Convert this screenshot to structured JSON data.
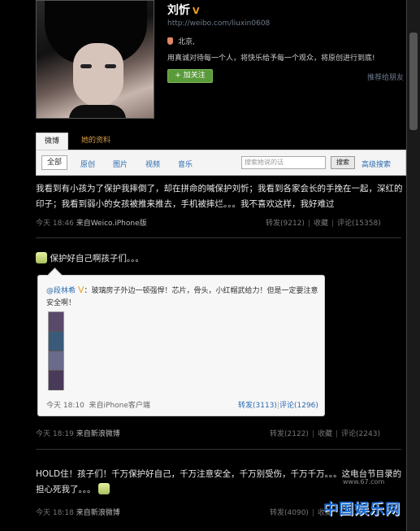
{
  "profile": {
    "name": "刘忻",
    "url": "http://weibo.com/liuxin0608",
    "location": "北京,",
    "bio": "用真诚对待每一个人，将快乐给予每一个观众，将原创进行到底!",
    "follow_label": "+ 加关注",
    "recommend_label": "推荐给朋友"
  },
  "tabs": {
    "weibo": "微博",
    "profile": "她的资料"
  },
  "filters": {
    "all": "全部",
    "original": "原创",
    "pictures": "图片",
    "video": "视频",
    "music": "音乐",
    "search_placeholder": "搜索她说的话",
    "search_button": "搜索",
    "advanced_search": "高级搜索"
  },
  "posts": [
    {
      "text": "我看到有小孩为了保护我摔倒了，却在拼命的喊保护刘忻；我看到各家会长的手挽在一起，深红的印子；我看到弱小的女孩被推来推去，手机被摔烂。。。我不喜欢这样，我好难过",
      "time": "今天 18:46",
      "source": "来自Weico.iPhone版",
      "repost": "转发(9212)",
      "favorite": "收藏",
      "comment": "评论(15358)"
    },
    {
      "text": "保护好自己啊孩子们。。。",
      "time": "今天 18:19",
      "source": "来自新浪微博",
      "repost": "转发(2122)",
      "favorite": "收藏",
      "comment": "评论(2243)",
      "original": {
        "author": "@段林希",
        "text": "：玻璃房子外边一顿强悍！芯片，骨头，小红帽武给力！但是一定要注意安全啊！",
        "time": "今天 18:10",
        "source": "来自iPhone客户端",
        "repost": "转发(3113)",
        "comment": "评论(1296)"
      }
    },
    {
      "text": "HOLD住！孩子们！千万保护好自己，千万注意安全，千万别受伤，千万千万。。。这电台节目录的担心死我了。。。",
      "time": "今天 18:18",
      "source": "来自新浪微博",
      "repost": "转发(4090)",
      "favorite": "收藏"
    }
  ],
  "watermark": {
    "brand": "中国娱乐网",
    "site": "www.67.com"
  }
}
